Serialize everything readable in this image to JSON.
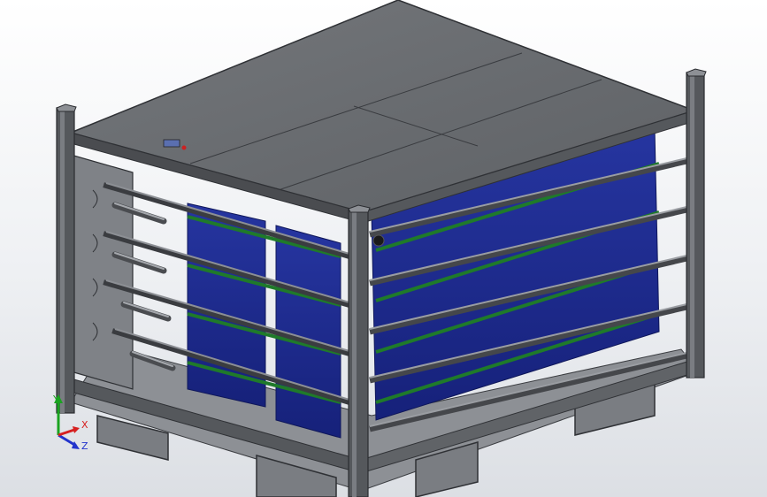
{
  "app": {
    "view": "cad-3d-viewport",
    "model": "rack-frame-with-drawers"
  },
  "colors": {
    "background_top": "#ffffff",
    "background_bottom": "#dcdfe4",
    "frame_metal": "#5d5f63",
    "frame_dark": "#3a3c40",
    "frame_light": "#86898e",
    "panel_blue": "#1f2e8f",
    "panel_blue_dark": "#141f66",
    "rail_green": "#1f7a2a",
    "lid_top": "#6b6e72",
    "floor": "#8d9095"
  },
  "triad": {
    "x_label": "X",
    "y_label": "Y",
    "z_label": "Z",
    "x_color": "#d62020",
    "y_color": "#1aa320",
    "z_color": "#2233cc"
  }
}
